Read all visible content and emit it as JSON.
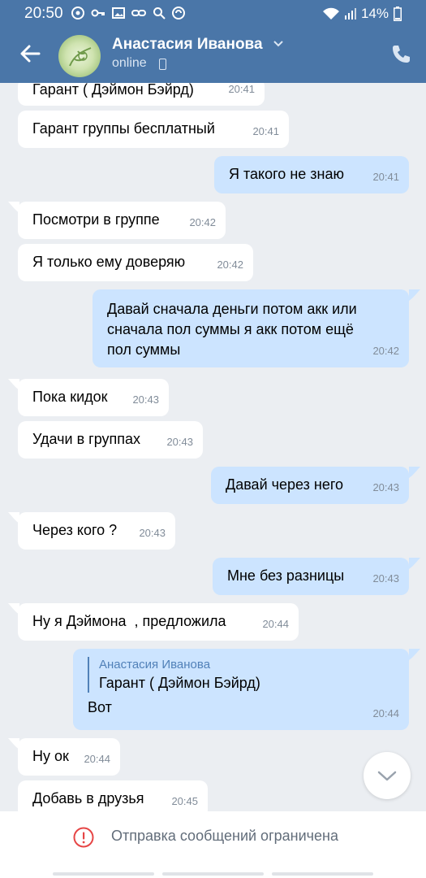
{
  "status_bar": {
    "time": "20:50",
    "battery": "14%"
  },
  "header": {
    "contact_name": "Анастасия Иванова",
    "status": "online"
  },
  "messages": [
    {
      "dir": "in",
      "text": "Гарант ( Дэймон Бэйрд)",
      "time": "20:41"
    },
    {
      "dir": "in",
      "text": "Гарант группы бесплатный",
      "time": "20:41"
    },
    {
      "dir": "out",
      "text": "Я такого не знаю",
      "time": "20:41"
    },
    {
      "dir": "in",
      "text": "Посмотри в группе",
      "time": "20:42"
    },
    {
      "dir": "in",
      "text": "Я только ему доверяю",
      "time": "20:42"
    },
    {
      "dir": "out",
      "lines": [
        "Давай сначала деньги потом акк или",
        "сначала пол суммы я акк потом ещё",
        "пол суммы"
      ],
      "time": "20:42"
    },
    {
      "dir": "in",
      "text": "Пока кидок",
      "time": "20:43"
    },
    {
      "dir": "in",
      "text": "Удачи в группах",
      "time": "20:43"
    },
    {
      "dir": "out",
      "text": "Давай через него",
      "time": "20:43"
    },
    {
      "dir": "in",
      "text": "Через кого ?",
      "time": "20:43"
    },
    {
      "dir": "out",
      "text": "Мне без разницы",
      "time": "20:43"
    },
    {
      "dir": "in",
      "text": "Ну я Дэймона  , предложила",
      "time": "20:44"
    },
    {
      "dir": "out",
      "quote_author": "Анастасия Иванова",
      "quote_text": "Гарант ( Дэймон Бэйрд)",
      "text": "Вот",
      "time": "20:44"
    },
    {
      "dir": "in",
      "text": "Ну ок",
      "time": "20:44"
    },
    {
      "dir": "in",
      "text": "Добавь в друзья",
      "time": "20:45"
    }
  ],
  "footer": {
    "restriction_text": "Отправка сообщений ограничена"
  },
  "colors": {
    "header_bg": "#4a76a8",
    "incoming_bg": "#ffffff",
    "outgoing_bg": "#cce4ff",
    "warning": "#e64646"
  }
}
